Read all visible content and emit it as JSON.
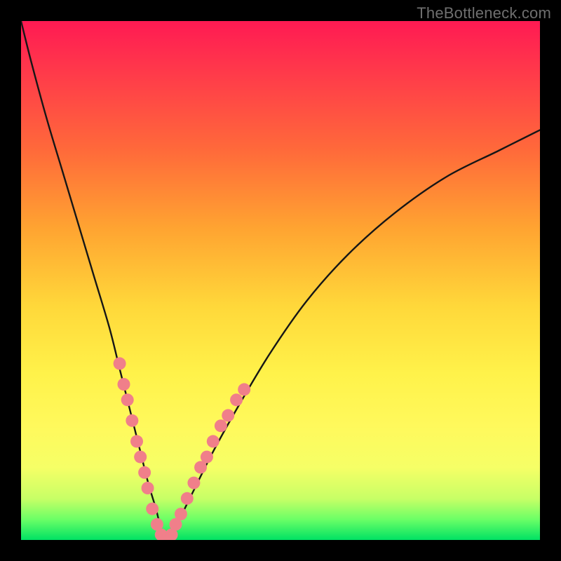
{
  "watermark": "TheBottleneck.com",
  "colors": {
    "frame": "#000000",
    "curve": "#161616",
    "dots": "#f07f8a",
    "gradient_top": "#ff1a53",
    "gradient_bottom": "#00e264"
  },
  "chart_data": {
    "type": "line",
    "title": "",
    "xlabel": "",
    "ylabel": "",
    "xlim": [
      0,
      100
    ],
    "ylim": [
      0,
      100
    ],
    "annotations": [
      "TheBottleneck.com"
    ],
    "series": [
      {
        "name": "bottleneck-curve",
        "x": [
          0,
          2,
          5,
          8,
          11,
          14,
          17,
          19,
          21,
          23,
          24.5,
          26,
          27,
          28,
          30,
          33,
          37,
          42,
          48,
          55,
          63,
          72,
          82,
          92,
          100
        ],
        "y": [
          100,
          92,
          81,
          71,
          61,
          51,
          41,
          33,
          25,
          17,
          11,
          6,
          2,
          0,
          3,
          9,
          17,
          26,
          36,
          46,
          55,
          63,
          70,
          75,
          79
        ]
      }
    ],
    "scatter_points": {
      "name": "highlighted-range",
      "points": [
        {
          "x": 19.0,
          "y": 34
        },
        {
          "x": 19.8,
          "y": 30
        },
        {
          "x": 20.5,
          "y": 27
        },
        {
          "x": 21.4,
          "y": 23
        },
        {
          "x": 22.3,
          "y": 19
        },
        {
          "x": 23.0,
          "y": 16
        },
        {
          "x": 23.8,
          "y": 13
        },
        {
          "x": 24.4,
          "y": 10
        },
        {
          "x": 25.3,
          "y": 6
        },
        {
          "x": 26.2,
          "y": 3
        },
        {
          "x": 27.0,
          "y": 1
        },
        {
          "x": 28.0,
          "y": 0
        },
        {
          "x": 29.0,
          "y": 1
        },
        {
          "x": 29.8,
          "y": 3
        },
        {
          "x": 30.8,
          "y": 5
        },
        {
          "x": 32.0,
          "y": 8
        },
        {
          "x": 33.3,
          "y": 11
        },
        {
          "x": 34.6,
          "y": 14
        },
        {
          "x": 35.8,
          "y": 16
        },
        {
          "x": 37.0,
          "y": 19
        },
        {
          "x": 38.5,
          "y": 22
        },
        {
          "x": 39.9,
          "y": 24
        },
        {
          "x": 41.5,
          "y": 27
        },
        {
          "x": 43.0,
          "y": 29
        }
      ]
    }
  }
}
